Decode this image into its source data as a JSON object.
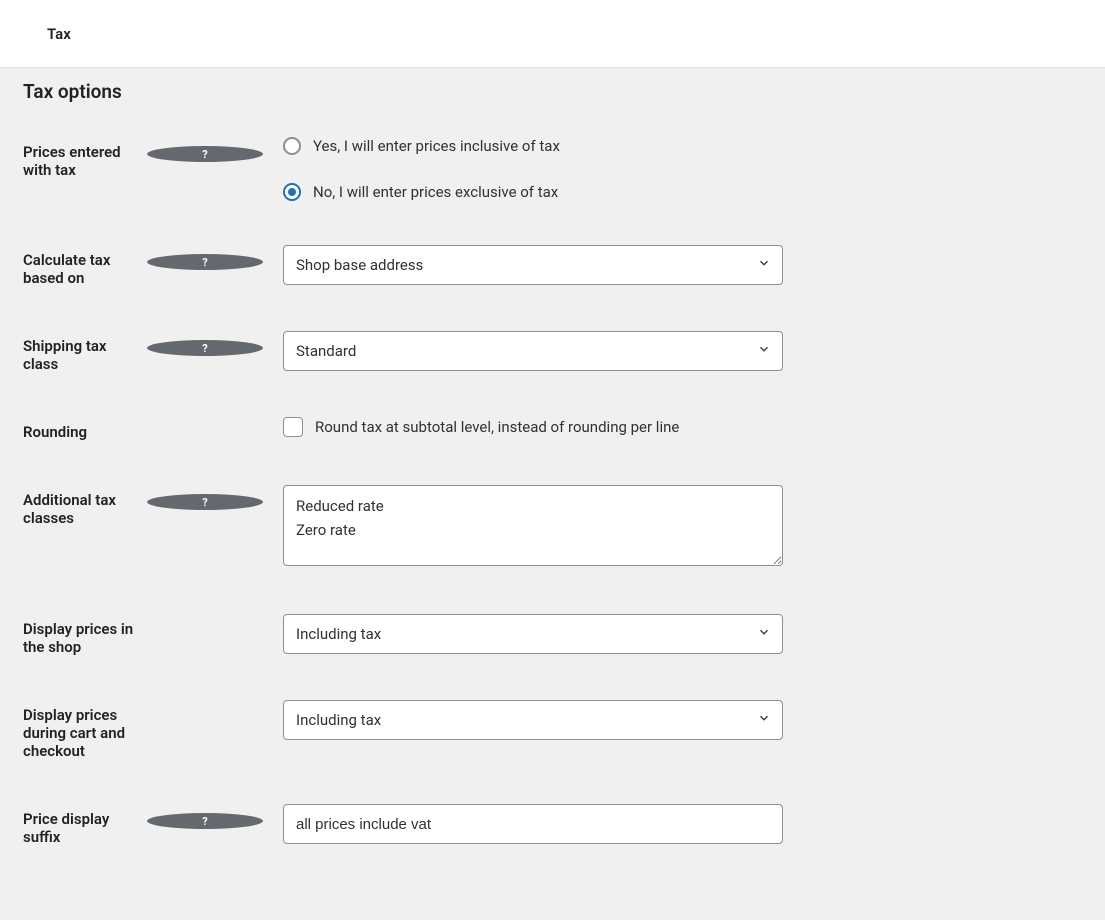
{
  "topbar": {
    "title": "Tax"
  },
  "section": {
    "title": "Tax options"
  },
  "fields": {
    "prices_entered": {
      "label": "Prices entered with tax",
      "options": {
        "inclusive": "Yes, I will enter prices inclusive of tax",
        "exclusive": "No, I will enter prices exclusive of tax"
      }
    },
    "calc_based_on": {
      "label": "Calculate tax based on",
      "value": "Shop base address"
    },
    "shipping_tax_class": {
      "label": "Shipping tax class",
      "value": "Standard"
    },
    "rounding": {
      "label": "Rounding",
      "option": "Round tax at subtotal level, instead of rounding per line"
    },
    "additional_classes": {
      "label": "Additional tax classes",
      "value": "Reduced rate\nZero rate"
    },
    "display_shop": {
      "label": "Display prices in the shop",
      "value": "Including tax"
    },
    "display_cart": {
      "label": "Display prices during cart and checkout",
      "value": "Including tax"
    },
    "price_suffix": {
      "label": "Price display suffix",
      "value": "all prices include vat"
    }
  }
}
